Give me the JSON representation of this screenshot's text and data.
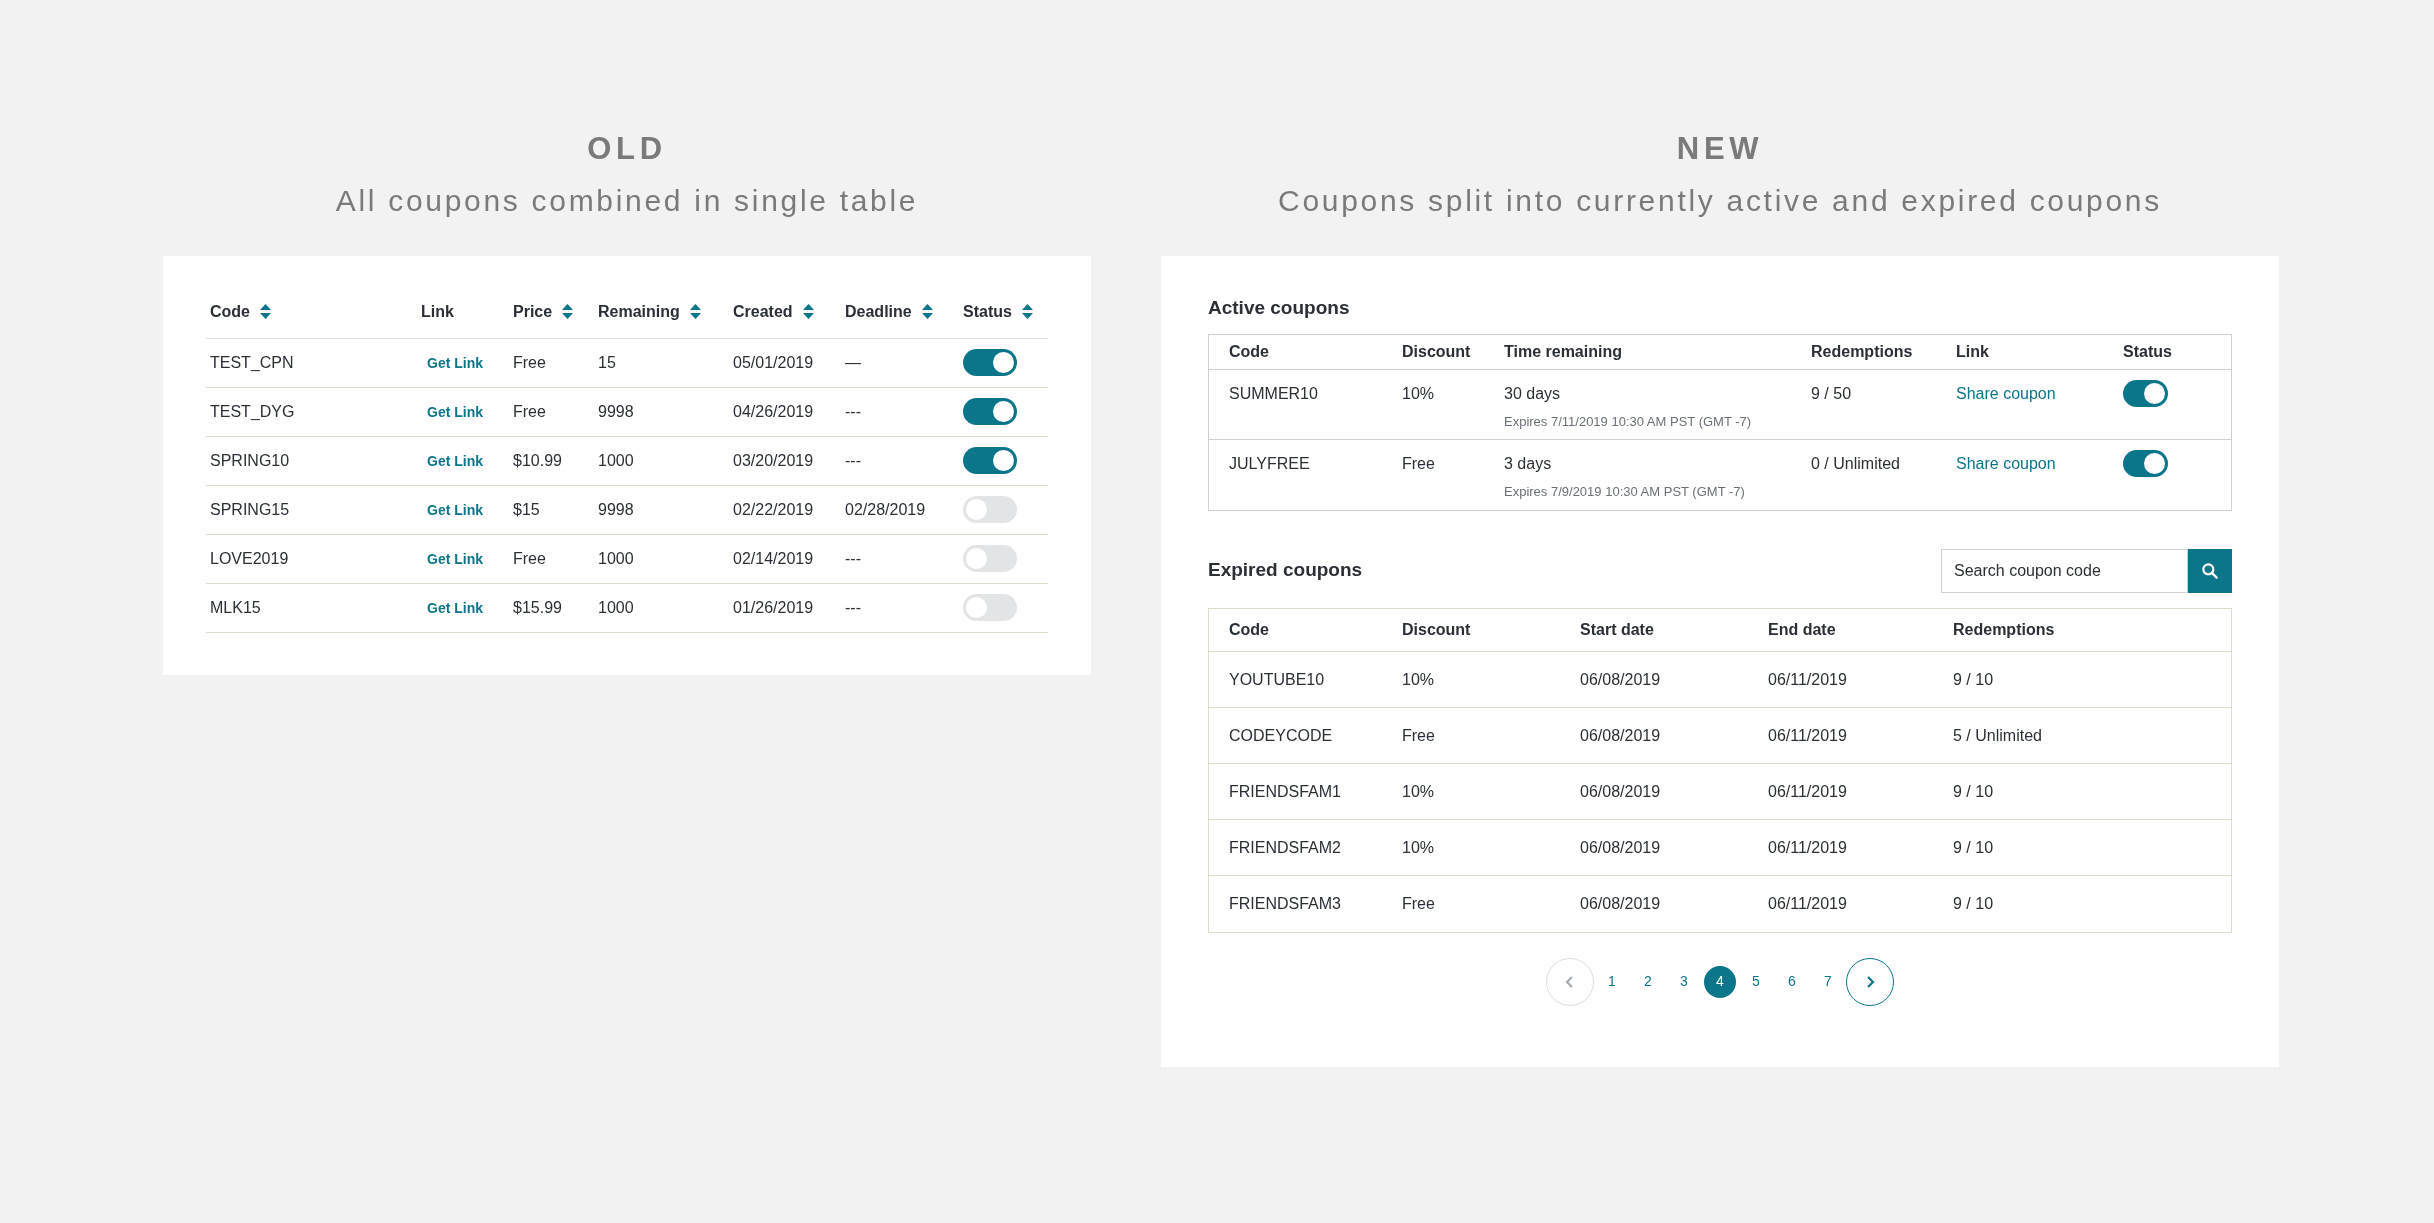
{
  "old": {
    "heading": "OLD",
    "subtitle": "All coupons combined in single table",
    "table": {
      "columns": [
        {
          "label": "Code",
          "sortable": true
        },
        {
          "label": "Link",
          "sortable": false
        },
        {
          "label": "Price",
          "sortable": true
        },
        {
          "label": "Remaining",
          "sortable": true
        },
        {
          "label": "Created",
          "sortable": true
        },
        {
          "label": "Deadline",
          "sortable": true
        },
        {
          "label": "Status",
          "sortable": true
        }
      ],
      "rows": [
        {
          "code": "TEST_CPN",
          "link": "Get Link",
          "price": "Free",
          "remaining": "15",
          "created": "05/01/2019",
          "deadline": "—",
          "on": true
        },
        {
          "code": "TEST_DYG",
          "link": "Get Link",
          "price": "Free",
          "remaining": "9998",
          "created": "04/26/2019",
          "deadline": "---",
          "on": true
        },
        {
          "code": "SPRING10",
          "link": "Get Link",
          "price": "$10.99",
          "remaining": "1000",
          "created": "03/20/2019",
          "deadline": "---",
          "on": true
        },
        {
          "code": "SPRING15",
          "link": "Get Link",
          "price": "$15",
          "remaining": "9998",
          "created": "02/22/2019",
          "deadline": "02/28/2019",
          "on": false
        },
        {
          "code": "LOVE2019",
          "link": "Get Link",
          "price": "Free",
          "remaining": "1000",
          "created": "02/14/2019",
          "deadline": "---",
          "on": false
        },
        {
          "code": "MLK15",
          "link": "Get Link",
          "price": "$15.99",
          "remaining": "1000",
          "created": "01/26/2019",
          "deadline": "---",
          "on": false
        }
      ]
    }
  },
  "new": {
    "heading": "NEW",
    "subtitle": "Coupons split into currently active and expired coupons",
    "active_coupons": {
      "title": "Active coupons",
      "columns": [
        "Code",
        "Discount",
        "Time remaining",
        "Redemptions",
        "Link",
        "Status"
      ],
      "rows": [
        {
          "code": "SUMMER10",
          "discount": "10%",
          "time_remaining": "30 days",
          "expires": "Expires 7/11/2019 10:30 AM PST (GMT -7)",
          "redemptions": "9 / 50",
          "link": "Share coupon",
          "on": true
        },
        {
          "code": "JULYFREE",
          "discount": "Free",
          "time_remaining": "3 days",
          "expires": "Expires 7/9/2019 10:30 AM PST (GMT -7)",
          "redemptions": "0 / Unlimited",
          "link": "Share coupon",
          "on": true
        }
      ]
    },
    "expired_coupons": {
      "title": "Expired coupons",
      "search": {
        "placeholder": "Search coupon code"
      },
      "columns": [
        "Code",
        "Discount",
        "Start date",
        "End date",
        "Redemptions"
      ],
      "rows": [
        [
          "YOUTUBE10",
          "10%",
          "06/08/2019",
          "06/11/2019",
          "9 / 10"
        ],
        [
          "CODEYCODE",
          "Free",
          "06/08/2019",
          "06/11/2019",
          "5 / Unlimited"
        ],
        [
          "FRIENDSFAM1",
          "10%",
          "06/08/2019",
          "06/11/2019",
          "9 / 10"
        ],
        [
          "FRIENDSFAM2",
          "10%",
          "06/08/2019",
          "06/11/2019",
          "9 / 10"
        ],
        [
          "FRIENDSFAM3",
          "Free",
          "06/08/2019",
          "06/11/2019",
          "9 / 10"
        ]
      ]
    },
    "pagination": {
      "previous": {
        "disabled": true
      },
      "next": {
        "disabled": false
      },
      "pages": [
        {
          "label": "1",
          "selected": false
        },
        {
          "label": "2",
          "selected": false
        },
        {
          "label": "3",
          "selected": false
        },
        {
          "label": "4",
          "selected": true
        },
        {
          "label": "5",
          "selected": false
        },
        {
          "label": "6",
          "selected": false
        },
        {
          "label": "7",
          "selected": false
        }
      ]
    }
  }
}
